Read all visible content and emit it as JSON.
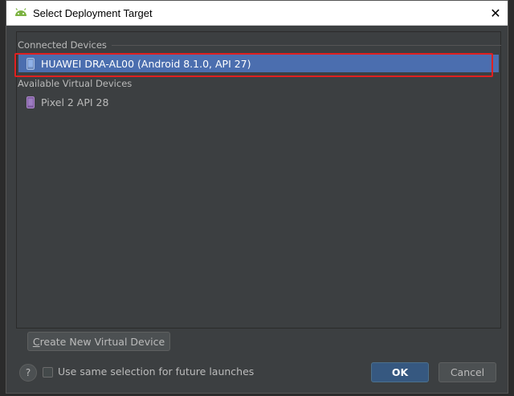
{
  "dialog": {
    "title": "Select Deployment Target",
    "title_icon": "android-icon",
    "close_glyph": "✕"
  },
  "device_list": {
    "connected_header": "Connected Devices",
    "connected_devices": [
      {
        "label": "HUAWEI DRA-AL00 (Android 8.1.0, API 27)",
        "icon": "phone-icon",
        "selected": true
      }
    ],
    "virtual_header": "Available Virtual Devices",
    "virtual_devices": [
      {
        "label": "Pixel 2 API 28",
        "icon": "phone-icon",
        "selected": false
      }
    ]
  },
  "footer": {
    "create_button_mnemonic": "C",
    "create_button_rest": "reate New Virtual Device",
    "help_glyph": "?",
    "checkbox_label": "Use same selection for future launches",
    "checkbox_checked": false,
    "ok_label": "OK",
    "cancel_label": "Cancel"
  },
  "colors": {
    "dialog_bg": "#3c3f41",
    "selection": "#4b6eaf",
    "highlight_outline": "#e02020",
    "ok_button": "#365880"
  }
}
